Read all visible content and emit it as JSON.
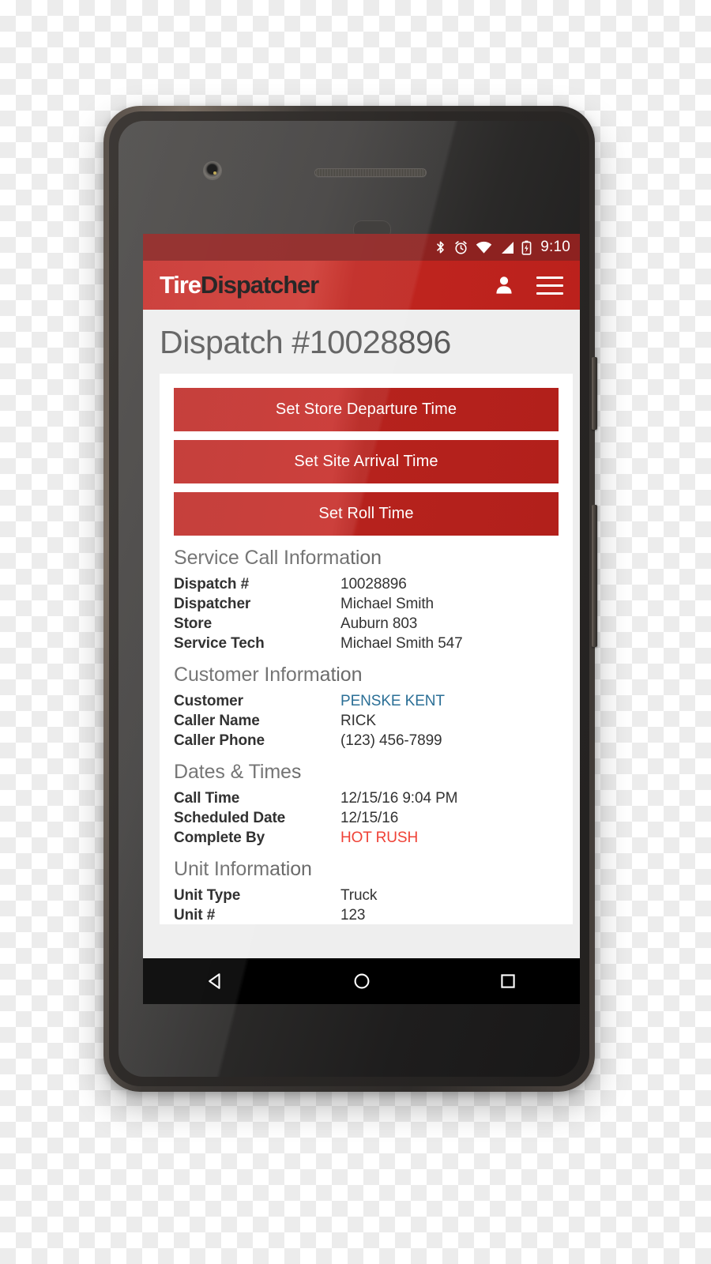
{
  "device": {
    "type": "android-smartphone",
    "frame_color": "#3c3835"
  },
  "status_bar": {
    "icons": [
      "bluetooth-icon",
      "alarm-icon",
      "wifi-icon",
      "cellular-signal-icon",
      "battery-charging-icon"
    ],
    "time": "9:10",
    "background": "#8d2220"
  },
  "app_bar": {
    "brand_part1": "Tire",
    "brand_part2": "Dispatcher",
    "background": "#c0251f",
    "icons": [
      "account-icon",
      "hamburger-menu-icon"
    ]
  },
  "page": {
    "title": "Dispatch #10028896",
    "background": "#eeeeee"
  },
  "actions": [
    {
      "label": "Set Store Departure Time"
    },
    {
      "label": "Set Site Arrival Time"
    },
    {
      "label": "Set Roll Time"
    }
  ],
  "sections": [
    {
      "heading": "Service Call Information",
      "rows": [
        {
          "label": "Dispatch #",
          "value": "10028896",
          "style": "normal"
        },
        {
          "label": "Dispatcher",
          "value": "Michael Smith",
          "style": "normal"
        },
        {
          "label": "Store",
          "value": "Auburn 803",
          "style": "normal"
        },
        {
          "label": "Service Tech",
          "value": "Michael Smith 547",
          "style": "normal"
        }
      ]
    },
    {
      "heading": "Customer Information",
      "rows": [
        {
          "label": "Customer",
          "value": "PENSKE KENT",
          "style": "link"
        },
        {
          "label": "Caller Name",
          "value": "RICK",
          "style": "normal"
        },
        {
          "label": "Caller Phone",
          "value": "(123) 456-7899",
          "style": "normal"
        }
      ]
    },
    {
      "heading": "Dates & Times",
      "rows": [
        {
          "label": "Call Time",
          "value": "12/15/16 9:04 PM",
          "style": "normal"
        },
        {
          "label": "Scheduled Date",
          "value": "12/15/16",
          "style": "normal"
        },
        {
          "label": "Complete By",
          "value": "HOT RUSH",
          "style": "alert"
        }
      ]
    },
    {
      "heading": "Unit Information",
      "rows": [
        {
          "label": "Unit Type",
          "value": "Truck",
          "style": "normal"
        },
        {
          "label": "Unit #",
          "value": "123",
          "style": "normal"
        }
      ]
    }
  ],
  "nav_bar": {
    "buttons": [
      "back-icon",
      "home-icon",
      "recents-icon"
    ],
    "background": "#000000"
  },
  "colors": {
    "brand_red": "#c0251f",
    "status_red": "#8d2220",
    "link_blue": "#2b6f96",
    "alert_red": "#ef4136",
    "page_gray": "#eeeeee"
  }
}
